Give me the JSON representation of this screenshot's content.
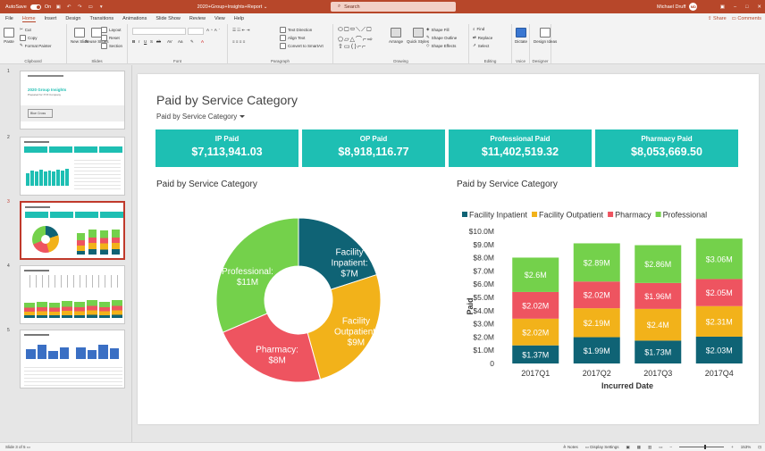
{
  "titlebar": {
    "autosave_label": "AutoSave",
    "autosave_state": "On",
    "doc_title": "2020+Group+Insights+Report",
    "search_placeholder": "Search",
    "user_name": "Michael Druff",
    "user_initials": "MD"
  },
  "menu": {
    "tabs": [
      "File",
      "Home",
      "Insert",
      "Design",
      "Transitions",
      "Animations",
      "Slide Show",
      "Review",
      "View",
      "Help"
    ],
    "active_tab": "Home",
    "share_label": "Share",
    "comments_label": "Comments"
  },
  "ribbon": {
    "clipboard": {
      "paste": "Paste",
      "cut": "Cut",
      "copy": "Copy",
      "format_painter": "Format Painter",
      "group": "Clipboard"
    },
    "slides": {
      "new_slide": "New Slide",
      "reuse_slides": "Reuse Slides",
      "layout": "Layout",
      "reset": "Reset",
      "section": "Section",
      "group": "Slides"
    },
    "font": {
      "group": "Font"
    },
    "paragraph": {
      "text_direction": "Text Direction",
      "align_text": "Align Text",
      "convert_smartart": "Convert to SmartArt",
      "group": "Paragraph"
    },
    "drawing": {
      "arrange": "Arrange",
      "quick_styles": "Quick Styles",
      "shape_fill": "Shape Fill",
      "shape_outline": "Shape Outline",
      "shape_effects": "Shape Effects",
      "group": "Drawing"
    },
    "editing": {
      "find": "Find",
      "replace": "Replace",
      "select": "Select",
      "group": "Editing"
    },
    "voice": {
      "dictate": "Dictate",
      "group": "Voice"
    },
    "designer": {
      "design_ideas": "Design Ideas",
      "group": "Designer"
    }
  },
  "thumbnails": {
    "numbers": [
      "1",
      "2",
      "3",
      "4",
      "5"
    ],
    "t1_title": "2020 Group Insights",
    "t1_sub": "Prepared for XYZ Company",
    "t1_logo": "Blue Cross"
  },
  "slide": {
    "title": "Paid by Service Category",
    "dropdown": "Paid by Service Category",
    "kpis": [
      {
        "label": "IP Paid",
        "value": "$7,113,941.03"
      },
      {
        "label": "OP Paid",
        "value": "$8,918,116.77"
      },
      {
        "label": "Professional Paid",
        "value": "$11,402,519.32"
      },
      {
        "label": "Pharmacy Paid",
        "value": "$8,053,669.50"
      }
    ]
  },
  "chart_data": [
    {
      "type": "pie",
      "title": "Paid by Service Category",
      "donut": true,
      "slices": [
        {
          "label": "Facility Inpatient",
          "data_label": "Facility Inpatient: $7M",
          "value": 7,
          "color": "#0f6375"
        },
        {
          "label": "Facility Outpatient",
          "data_label": "Facility Outpatient: $9M",
          "value": 9,
          "color": "#f2b21a"
        },
        {
          "label": "Pharmacy",
          "data_label": "Pharmacy: $8M",
          "value": 8,
          "color": "#ee5460"
        },
        {
          "label": "Professional",
          "data_label": "Professional: $11M",
          "value": 11,
          "color": "#74d14b"
        }
      ]
    },
    {
      "type": "bar",
      "stacked": true,
      "title": "Paid by Service Category",
      "xlabel": "Incurred Date",
      "ylabel": "Paid",
      "categories": [
        "2017Q1",
        "2017Q2",
        "2017Q3",
        "2017Q4"
      ],
      "ylim": [
        0,
        10
      ],
      "yticks": [
        "0",
        "$1.0M",
        "$2.0M",
        "$3.0M",
        "$4.0M",
        "$5.0M",
        "$6.0M",
        "$7.0M",
        "$8.0M",
        "$9.0M",
        "$10.0M"
      ],
      "legend_position": "top",
      "series": [
        {
          "name": "Facility Inpatient",
          "color": "#0f6375",
          "values": [
            1.37,
            1.99,
            1.73,
            2.03
          ],
          "labels": [
            "$1.37M",
            "$1.99M",
            "$1.73M",
            "$2.03M"
          ]
        },
        {
          "name": "Facility Outpatient",
          "color": "#f2b21a",
          "values": [
            2.02,
            2.19,
            2.4,
            2.31
          ],
          "labels": [
            "$2.02M",
            "$2.19M",
            "$2.4M",
            "$2.31M"
          ]
        },
        {
          "name": "Pharmacy",
          "color": "#ee5460",
          "values": [
            2.02,
            2.02,
            1.96,
            2.05
          ],
          "labels": [
            "$2.02M",
            "$2.02M",
            "$1.96M",
            "$2.05M"
          ]
        },
        {
          "name": "Professional",
          "color": "#74d14b",
          "values": [
            2.6,
            2.89,
            2.86,
            3.06
          ],
          "labels": [
            "$2.6M",
            "$2.89M",
            "$2.86M",
            "$3.06M"
          ]
        }
      ]
    }
  ],
  "statusbar": {
    "slide_info": "Slide 3 of 5",
    "notes": "Notes",
    "display_settings": "Display Settings",
    "zoom": "153%"
  }
}
